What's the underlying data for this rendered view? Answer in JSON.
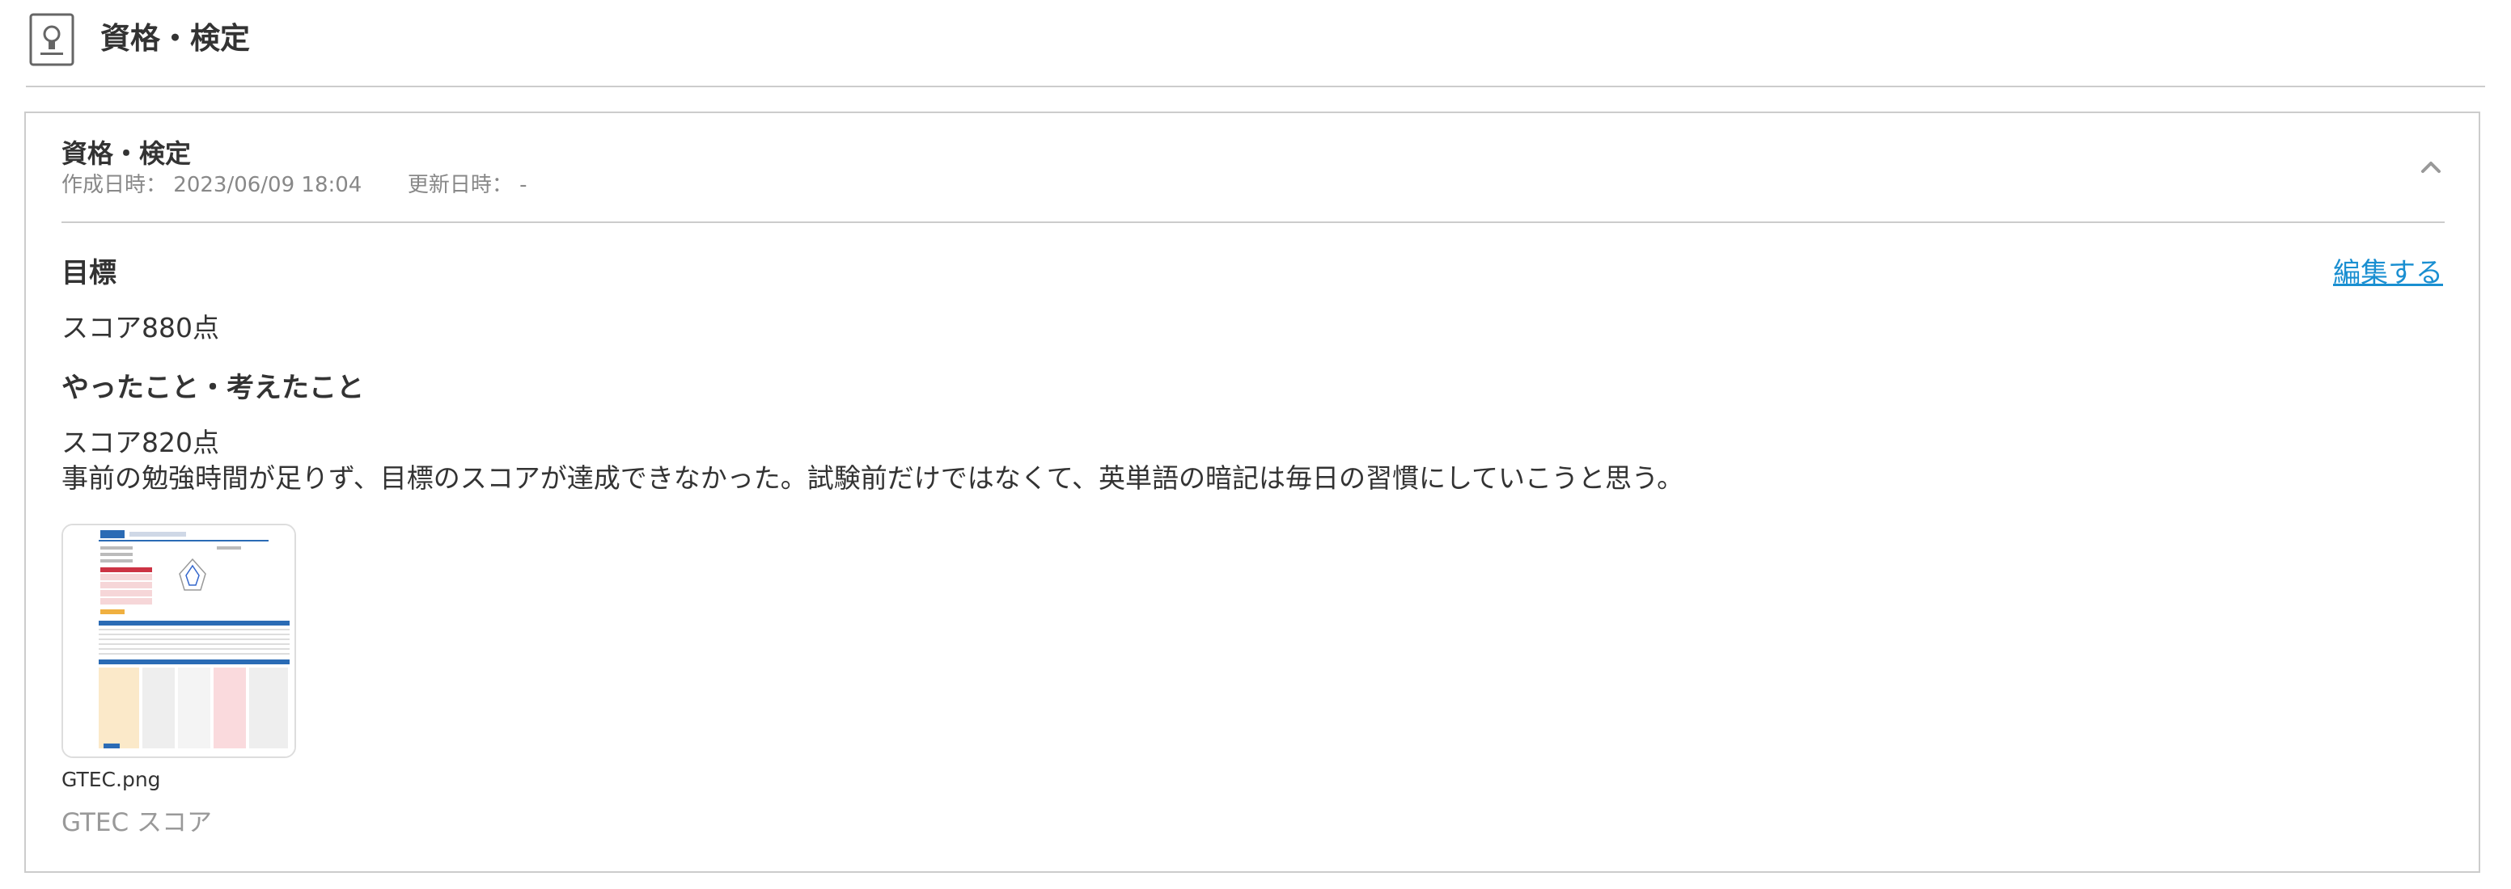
{
  "header": {
    "title": "資格・検定",
    "icon": "certificate-icon"
  },
  "record": {
    "title": "資格・検定",
    "created_label": "作成日時：",
    "created_value": "2023/06/09 18:04",
    "updated_label": "更新日時：",
    "updated_value": "-",
    "collapse_icon": "chevron-up-icon",
    "edit_label": "編集する",
    "goal_heading": "目標",
    "goal_text": "スコア880点",
    "reflection_heading": "やったこと・考えたこと",
    "reflection_lines": [
      "スコア820点",
      "事前の勉強時間が足りず、目標のスコアが達成できなかった。試験前だけではなくて、英単語の暗記は毎日の習慣にしていこうと思う。"
    ],
    "attachment": {
      "thumbnail_icon": "image-thumbnail",
      "file_name": "GTEC.png",
      "caption": "GTEC スコア"
    }
  },
  "colors": {
    "link": "#1a8fd1",
    "border": "#cccccc",
    "muted_text": "#888888",
    "body_text": "#333333"
  }
}
